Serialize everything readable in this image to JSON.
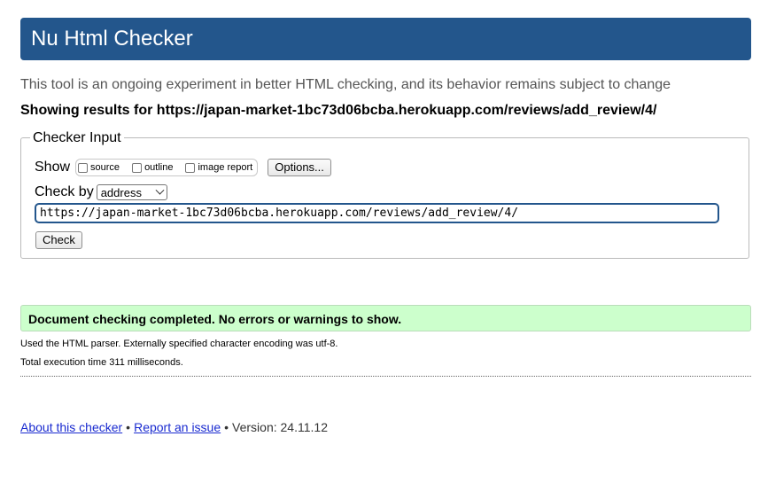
{
  "header": {
    "title": "Nu Html Checker"
  },
  "intro": "This tool is an ongoing experiment in better HTML checking, and its behavior remains subject to change",
  "results_for": "Showing results for https://japan-market-1bc73d06bcba.herokuapp.com/reviews/add_review/4/",
  "checker_input": {
    "legend": "Checker Input",
    "show_label": "Show",
    "options": {
      "source": "source",
      "outline": "outline",
      "image_report": "image report"
    },
    "options_button": "Options...",
    "check_by_label": "Check by",
    "check_by_value": "address",
    "url_value": "https://japan-market-1bc73d06bcba.herokuapp.com/reviews/add_review/4/",
    "check_button": "Check"
  },
  "result": {
    "success_message": "Document checking completed. No errors or warnings to show.",
    "parser_info": "Used the HTML parser. Externally specified character encoding was utf-8.",
    "execution_time": "Total execution time 311 milliseconds."
  },
  "footer": {
    "about_link": "About this checker",
    "separator": "•",
    "report_link": "Report an issue",
    "version": "Version: 24.11.12"
  },
  "colors": {
    "header_bg": "#23568c",
    "success_bg": "#ccffcc",
    "link": "#1a2bd0"
  }
}
